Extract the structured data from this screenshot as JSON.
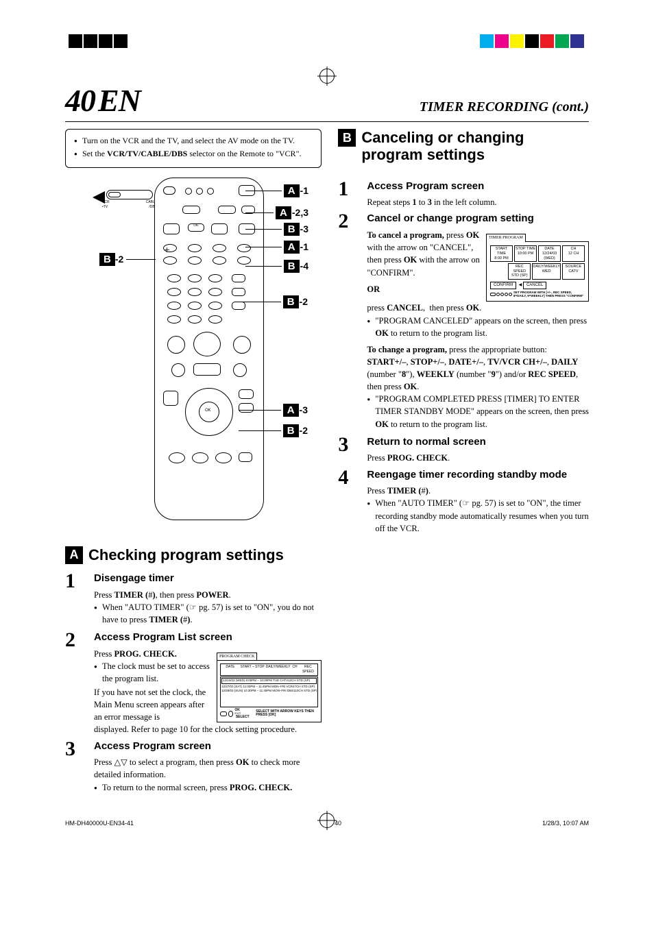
{
  "page_number": "40",
  "page_suffix": "EN",
  "section_title": "TIMER RECORDING (cont.)",
  "pre_notes": [
    "Turn on the VCR and the TV, and select the AV mode on the TV.",
    "Set the VCR/TV/CABLE/DBS selector on the Remote to \"VCR\"."
  ],
  "remote": {
    "switch_labels": [
      "VCR",
      "CABLE",
      "•TV",
      "/DBS"
    ],
    "callouts": {
      "A1": "-1",
      "A23": "-2,3",
      "B3": "-3",
      "A1b": "-1",
      "B2a": "-2",
      "B4": "-4",
      "B2b": "-2",
      "A3": "-3",
      "B2c": "-2"
    }
  },
  "section_a": {
    "badge": "A",
    "title": "Checking program settings",
    "steps": [
      {
        "num": "1",
        "title": "Disengage timer",
        "body_1": "Press TIMER (#), then press POWER.",
        "bullets": [
          "When \"AUTO TIMER\" (☞ pg. 57) is set to \"ON\", you do not have to press TIMER (#)."
        ]
      },
      {
        "num": "2",
        "title": "Access Program List screen",
        "body_1": "Press PROG. CHECK.",
        "bullets": [
          "The clock must be set to access the program list."
        ],
        "body_after": "If you have not set the clock, the Main Menu screen appears after an error message is displayed. Refer to page 10 for the clock setting procedure."
      },
      {
        "num": "3",
        "title": "Access Program screen",
        "body_1": "Press △▽ to select a program, then press OK to check more detailed information.",
        "bullets": [
          "To return to the normal screen, press PROG. CHECK."
        ]
      }
    ],
    "osd_program_check": {
      "tab": "PROGRAM CHECK",
      "headers": [
        "DATE",
        "START – STOP",
        "DAILY/WEEKLY",
        "CH",
        "REC SPEED"
      ],
      "rows": [
        "12/24/03 (WED) 8:00PM – 10:00PM    TUE    CATV12CH  STD (SP)",
        "12/27/03 (SAT) 11:00PM – 11:45PM  MON–FRI  VCR47CH   STD (SP)",
        "12/28/03 (SUN) 10:30PM – 11:45PM  MON–FRI  DBS110CH  STD (SP)"
      ],
      "footer1": "OK",
      "footer2": "SELECT",
      "footer3": "SELECT WITH ARROW KEYS THEN PRESS [OK]",
      "footer_exit": "EXIT"
    }
  },
  "section_b": {
    "badge": "B",
    "title": "Canceling or changing program settings",
    "steps": [
      {
        "num": "1",
        "title": "Access Program screen",
        "body_1": "Repeat steps 1 to 3 in the left column."
      },
      {
        "num": "2",
        "title": "Cancel or change program setting",
        "cancel_lead": "To cancel a program,",
        "cancel_body": "press OK with the arrow on \"CANCEL\", then press OK with the arrow on \"CONFIRM\".",
        "or": "OR",
        "or_body": "press CANCEL,  then press OK.",
        "cancel_bullets": [
          "\"PROGRAM CANCELED\" appears on the screen, then press OK to return to the program list."
        ],
        "change_lead": "To change a program,",
        "change_body_1": " press the appropriate button: START+/–, STOP+/–, DATE+/–, TV/VCR CH+/–, DAILY (number \"8\"), WEEKLY (number \"9\") and/or REC SPEED, then press OK.",
        "change_bullets": [
          "\"PROGRAM COMPLETED PRESS [TIMER] TO ENTER TIMER STANDBY MODE\" appears on the screen, then press OK to return to the program list."
        ]
      },
      {
        "num": "3",
        "title": "Return to normal screen",
        "body_1": "Press PROG. CHECK."
      },
      {
        "num": "4",
        "title": "Reengage timer recording standby mode",
        "body_1": "Press TIMER (#).",
        "bullets": [
          "When \"AUTO TIMER\" (☞ pg. 57) is set to \"ON\", the timer recording standby mode automatically resumes when you turn off the VCR."
        ]
      }
    ],
    "osd_timer_program": {
      "tab": "TIMER PROGRAM",
      "row1": [
        {
          "t": "START TIME",
          "b": "8:00 PM"
        },
        {
          "t": "STOP TIME",
          "b": "10:00 PM"
        },
        {
          "t": "DATE",
          "b": "12/24/03 (WED)"
        },
        {
          "t": "CH",
          "b": "12 CH"
        }
      ],
      "row2": [
        {
          "t": "REC SPEED",
          "b": "STD (SP)"
        },
        {
          "t": "DAILY/WEEKLY",
          "b": "WED"
        },
        {
          "t": "SOURCE",
          "b": "CATV"
        }
      ],
      "confirm": "CONFIRM",
      "cancel": "CANCEL",
      "hint": "SET PROGRAM WITH [+/–, REC SPEED, 8=DAILY, 9=WEEKLY] THEN PRESS \"CONFIRM\""
    }
  },
  "footer": {
    "left": "HM-DH40000U-EN34-41",
    "center": "40",
    "right": "1/28/3, 10:07 AM"
  },
  "colors": {
    "accent": "#000000"
  }
}
